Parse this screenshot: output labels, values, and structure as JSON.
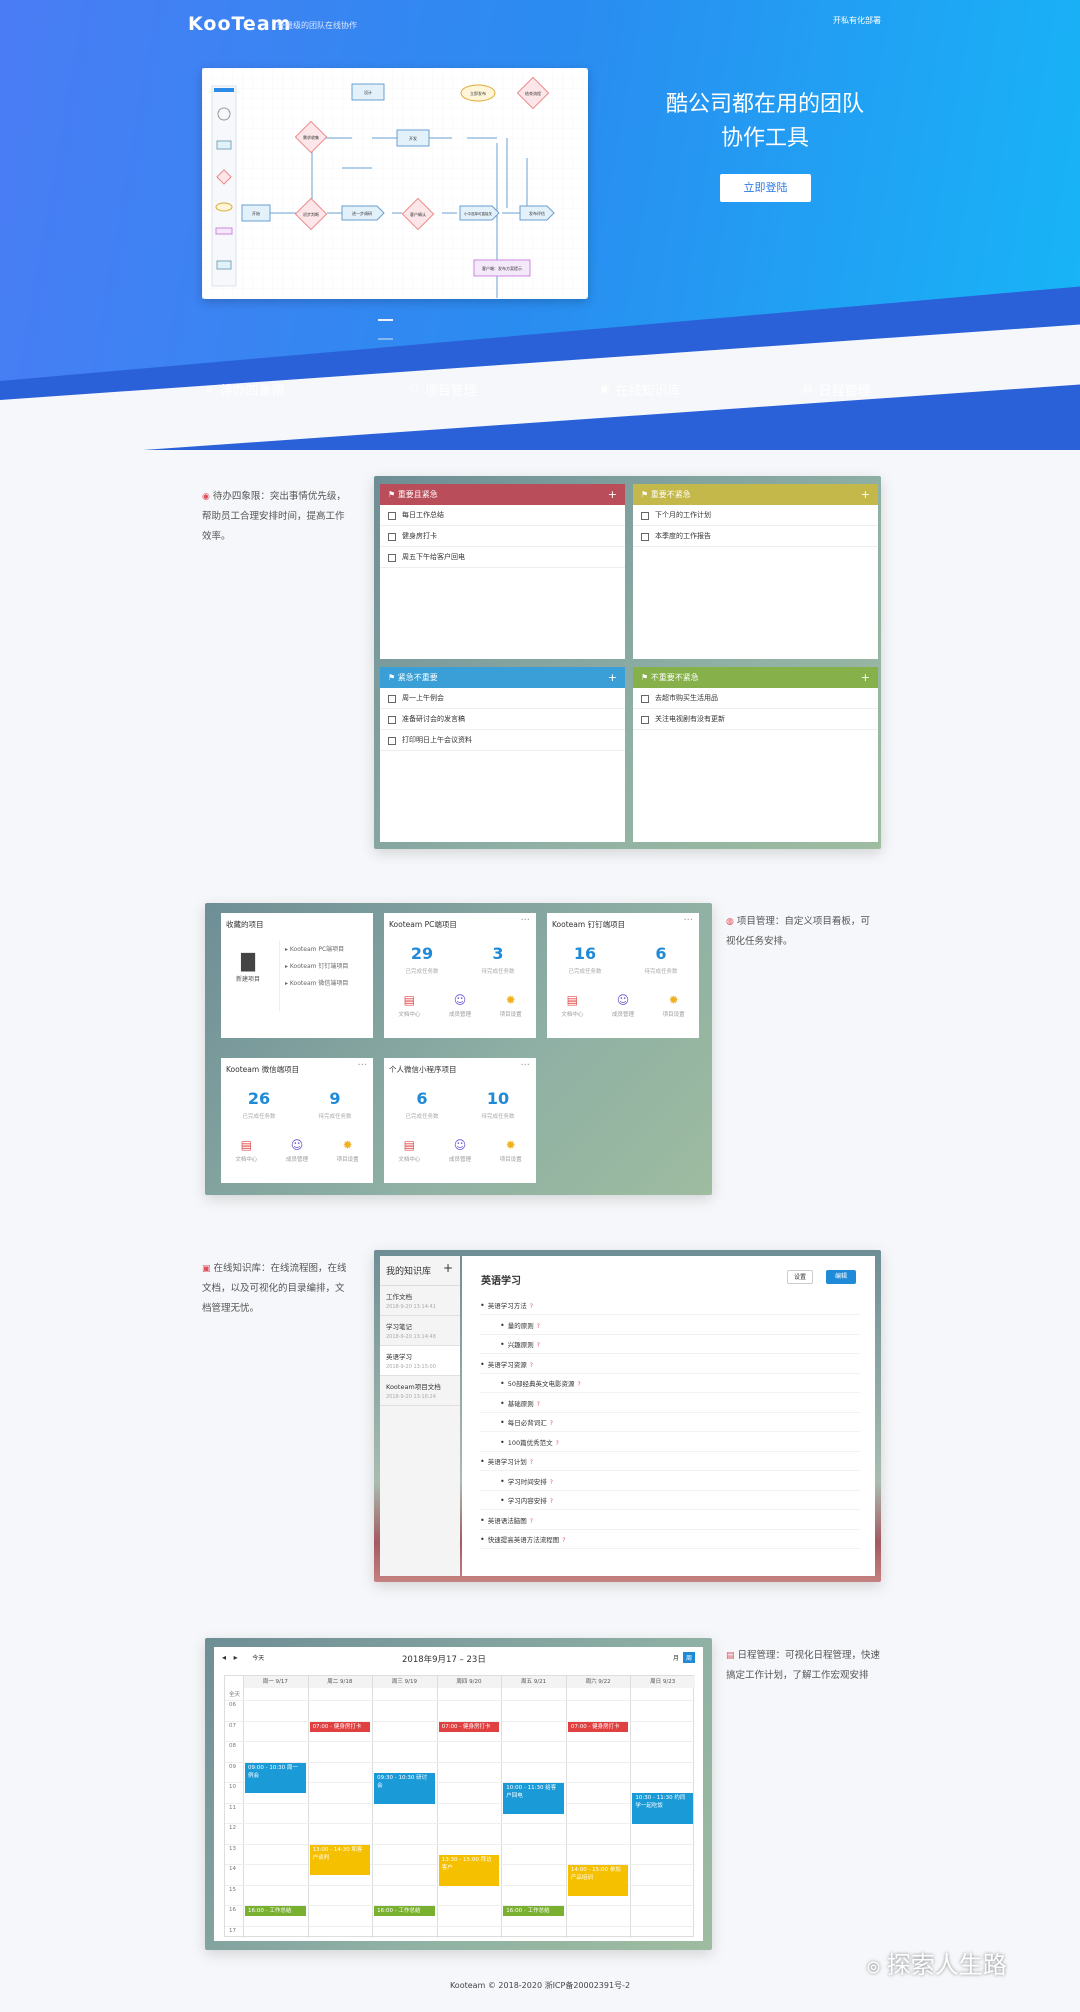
{
  "brand": {
    "name": "KooTeam",
    "tagline": "轻量级的团队在线协作",
    "top_right": "开私有化部署"
  },
  "hero": {
    "title_line1": "酷公司都在用的团队",
    "title_line2": "协作工具",
    "register": "立即登陆"
  },
  "flowchart": {
    "nodes": [
      "开始",
      "需求收集",
      "需求",
      "设计",
      "开发",
      "测试",
      "立即发布",
      "结束流程",
      "初步判断",
      "进一步调研",
      "客户确认",
      "小中选择可直接关",
      "发布评估",
      "客户端：发布方案提示"
    ]
  },
  "nav": [
    {
      "label": "待办四象限",
      "icon": "layers-icon"
    },
    {
      "label": "项目管理",
      "icon": "cube-icon"
    },
    {
      "label": "在线知识库",
      "icon": "doc-icon"
    },
    {
      "label": "日程管理",
      "icon": "calendar-icon"
    }
  ],
  "quadrant": {
    "desc": "待办四象限：突出事情优先级，帮助员工合理安排时间，提高工作效率。",
    "cards": [
      {
        "title": "重要且紧急",
        "color": "#b94d5a",
        "items": [
          "每日工作总结",
          "健身房打卡",
          "周五下午给客户回电"
        ]
      },
      {
        "title": "重要不紧急",
        "color": "#c5b84a",
        "items": [
          "下个月的工作计划",
          "本季度的工作报告"
        ]
      },
      {
        "title": "紧急不重要",
        "color": "#3a9fd6",
        "items": [
          "周一上午例会",
          "准备研讨会的发言稿",
          "打印明日上午会议资料"
        ]
      },
      {
        "title": "不重要不紧急",
        "color": "#86b04a",
        "items": [
          "去超市购买生活用品",
          "关注电视剧有没有更新"
        ]
      }
    ]
  },
  "projects": {
    "desc": "项目管理：自定义项目看板，可视化任务安排。",
    "fav": {
      "title": "收藏的项目",
      "new": "新建项目",
      "items": [
        "Kooteam PC端项目",
        "Kooteam 钉钉端项目",
        "Kooteam 微信端项目"
      ]
    },
    "done_label": "已完成任务数",
    "todo_label": "待完成任务数",
    "actions": [
      "文档中心",
      "成员管理",
      "项目设置"
    ],
    "cards": [
      {
        "title": "Kooteam PC端项目",
        "done": "29",
        "todo": "3"
      },
      {
        "title": "Kooteam 钉钉端项目",
        "done": "16",
        "todo": "6"
      },
      {
        "title": "Kooteam 微信端项目",
        "done": "26",
        "todo": "9"
      },
      {
        "title": "个人微信小程序项目",
        "done": "6",
        "todo": "10"
      }
    ]
  },
  "kb": {
    "desc": "在线知识库：在线流程图，在线文档，以及可视化的目录编排，文档管理无忧。",
    "sidebar_title": "我的知识库",
    "docs": [
      {
        "name": "工作文档",
        "time": "2018-9-20 13:14:41"
      },
      {
        "name": "学习笔记",
        "time": "2018-9-20 13:14:48"
      },
      {
        "name": "英语学习",
        "time": "2018-9-20 13:15:00"
      },
      {
        "name": "Kooteam项目文档",
        "time": "2018-9-20 13:16:24"
      }
    ],
    "doc_title": "英语学习",
    "btn_settings": "设置",
    "btn_edit": "编辑",
    "tree": [
      {
        "t": "英语学习方法",
        "l": 0
      },
      {
        "t": "量的原则",
        "l": 1
      },
      {
        "t": "兴趣原则",
        "l": 1
      },
      {
        "t": "英语学习资源",
        "l": 0
      },
      {
        "t": "50部经典英文电影资源",
        "l": 1
      },
      {
        "t": "基础原则",
        "l": 1
      },
      {
        "t": "每日必背词汇",
        "l": 1
      },
      {
        "t": "100篇优秀范文",
        "l": 1
      },
      {
        "t": "英语学习计划",
        "l": 0
      },
      {
        "t": "学习时间安排",
        "l": 1
      },
      {
        "t": "学习内容安排",
        "l": 1
      },
      {
        "t": "英语语法脑图",
        "l": 0
      },
      {
        "t": "快速提高英语方法流程图",
        "l": 0
      }
    ]
  },
  "calendar": {
    "desc": "日程管理：可视化日程管理，快速搞定工作计划，了解工作宏观安排",
    "range": "2018年9月17 – 23日",
    "today": "今天",
    "month": "月",
    "week": "周",
    "days": [
      "周一 9/17",
      "周二 9/18",
      "周三 9/19",
      "周四 9/20",
      "周五 9/21",
      "周六 9/22",
      "周日 9/23"
    ],
    "allday": "全天",
    "times": [
      "06",
      "07",
      "08",
      "09",
      "10",
      "11",
      "12",
      "13",
      "14",
      "15",
      "16",
      "17"
    ],
    "events": [
      {
        "day": 1,
        "start": 7,
        "dur": 0.5,
        "text": "07:00 - 健身房打卡",
        "color": "#e04040"
      },
      {
        "day": 3,
        "start": 7,
        "dur": 0.5,
        "text": "07:00 - 健身房打卡",
        "color": "#e04040"
      },
      {
        "day": 5,
        "start": 7,
        "dur": 0.5,
        "text": "07:00 - 健身房打卡",
        "color": "#e04040"
      },
      {
        "day": 0,
        "start": 9,
        "dur": 1.5,
        "text": "09:00 - 10:30 周一例会",
        "color": "#1b9ad8"
      },
      {
        "day": 2,
        "start": 9.5,
        "dur": 1.5,
        "text": "09:30 - 10:30 研讨会",
        "color": "#1b9ad8"
      },
      {
        "day": 4,
        "start": 10,
        "dur": 1.5,
        "text": "10:00 - 11:30 给客户回电",
        "color": "#1b9ad8"
      },
      {
        "day": 6,
        "start": 10.5,
        "dur": 1.5,
        "text": "10:30 - 11:30 约同学一起吃饭",
        "color": "#1b9ad8"
      },
      {
        "day": 1,
        "start": 13,
        "dur": 1.5,
        "text": "13:00 - 14:30 和客户谈判",
        "color": "#f5c000"
      },
      {
        "day": 3,
        "start": 13.5,
        "dur": 1.5,
        "text": "13:30 - 15:00 拜访客户",
        "color": "#f5c000"
      },
      {
        "day": 5,
        "start": 14,
        "dur": 1.5,
        "text": "14:00 - 15:00 参加产品培训",
        "color": "#f5c000"
      },
      {
        "day": 0,
        "start": 16,
        "dur": 0.5,
        "text": "16:00 - 工作总结",
        "color": "#7ab030"
      },
      {
        "day": 2,
        "start": 16,
        "dur": 0.5,
        "text": "16:00 - 工作总结",
        "color": "#7ab030"
      },
      {
        "day": 4,
        "start": 16,
        "dur": 0.5,
        "text": "16:00 - 工作总结",
        "color": "#7ab030"
      }
    ]
  },
  "footer": "Kooteam © 2018-2020  浙ICP备20002391号-2",
  "watermark": "探索人生路"
}
